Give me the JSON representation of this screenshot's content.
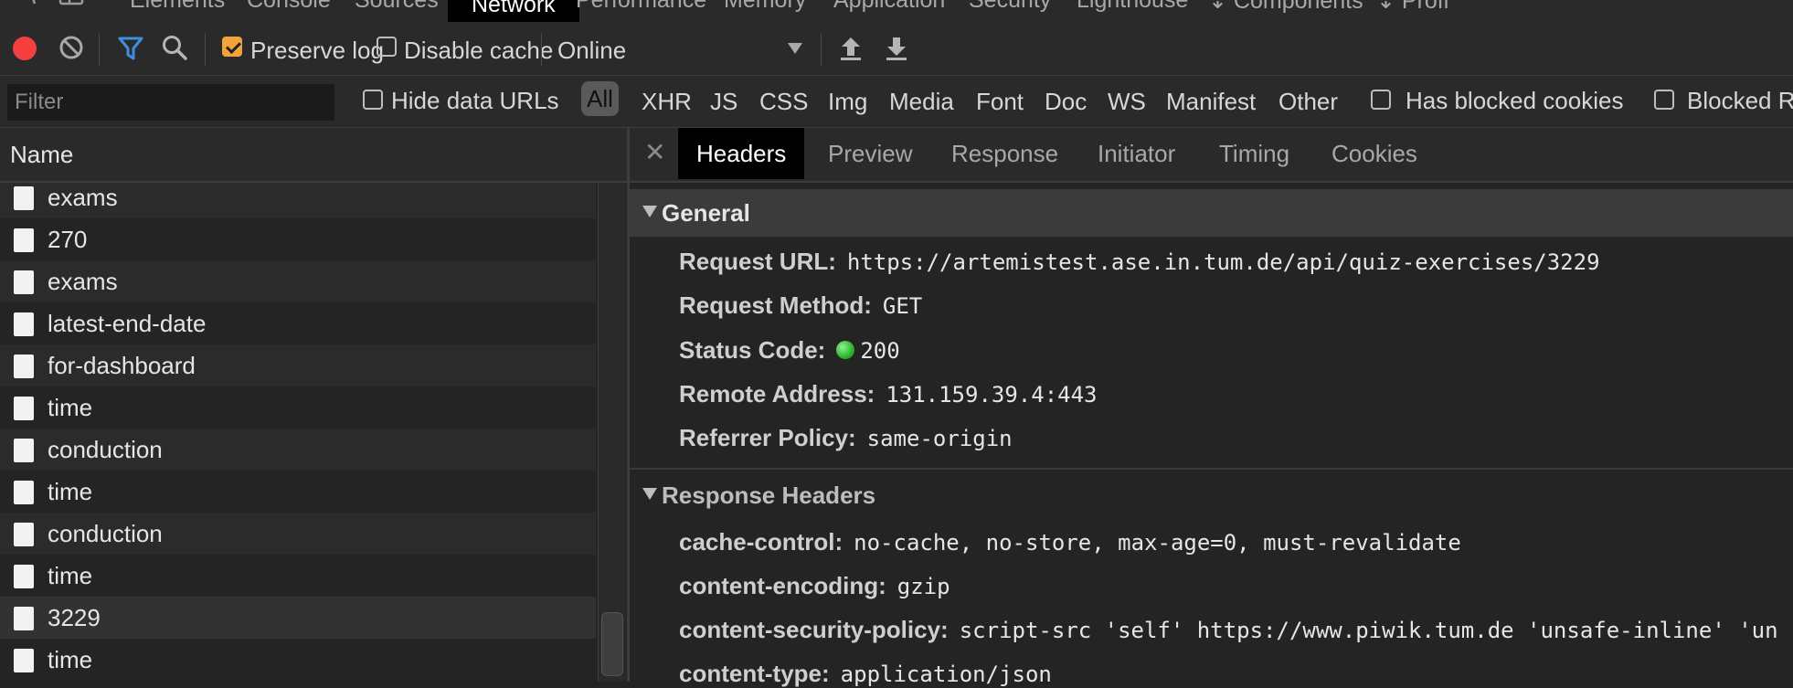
{
  "panel_tabs": [
    {
      "label": "Elements",
      "active": false
    },
    {
      "label": "Console",
      "active": false
    },
    {
      "label": "Sources",
      "active": false
    },
    {
      "label": "Network",
      "active": true
    },
    {
      "label": "Performance",
      "active": false
    },
    {
      "label": "Memory",
      "active": false
    },
    {
      "label": "Application",
      "active": false
    },
    {
      "label": "Security",
      "active": false
    },
    {
      "label": "Lighthouse",
      "active": false
    },
    {
      "label": "Components",
      "active": false
    },
    {
      "label": "Profi",
      "active": false
    }
  ],
  "toolbar": {
    "preserve_log_label": "Preserve log",
    "preserve_log_checked": true,
    "disable_cache_label": "Disable cache",
    "disable_cache_checked": false,
    "throttling_value": "Online",
    "icons": [
      "record-icon",
      "clear-icon",
      "filter-icon",
      "search-icon",
      "upload-icon",
      "download-icon"
    ],
    "record_color": "#f43f3f",
    "filter_icon_color": "#3d8fe0",
    "checkbox_accent": "#f2a33a"
  },
  "filterbar": {
    "filter_placeholder": "Filter",
    "hide_data_urls_label": "Hide data URLs",
    "types": [
      "All",
      "XHR",
      "JS",
      "CSS",
      "Img",
      "Media",
      "Font",
      "Doc",
      "WS",
      "Manifest",
      "Other"
    ],
    "active_type": "All",
    "has_blocked_cookies_label": "Has blocked cookies",
    "blocked_requests_label": "Blocked R"
  },
  "request_list": {
    "header": "Name",
    "rows": [
      "exams",
      "270",
      "exams",
      "latest-end-date",
      "for-dashboard",
      "time",
      "conduction",
      "time",
      "conduction",
      "time",
      "3229",
      "time"
    ]
  },
  "details": {
    "tabs": [
      "Headers",
      "Preview",
      "Response",
      "Initiator",
      "Timing",
      "Cookies"
    ],
    "active_tab": "Headers",
    "general": {
      "title": "General",
      "request_url_key": "Request URL:",
      "request_url": "https://artemistest.ase.in.tum.de/api/quiz-exercises/3229",
      "request_method_key": "Request Method:",
      "request_method": "GET",
      "status_code_key": "Status Code:",
      "status_code": "200",
      "status_color": "#2fc42f",
      "remote_address_key": "Remote Address:",
      "remote_address": "131.159.39.4:443",
      "referrer_policy_key": "Referrer Policy:",
      "referrer_policy": "same-origin"
    },
    "response_headers": {
      "title": "Response Headers",
      "items": [
        {
          "key": "cache-control:",
          "value": "no-cache, no-store, max-age=0, must-revalidate"
        },
        {
          "key": "content-encoding:",
          "value": "gzip"
        },
        {
          "key": "content-security-policy:",
          "value": "script-src 'self' https://www.piwik.tum.de 'unsafe-inline' 'un"
        },
        {
          "key": "content-type:",
          "value": "application/json"
        }
      ]
    }
  }
}
